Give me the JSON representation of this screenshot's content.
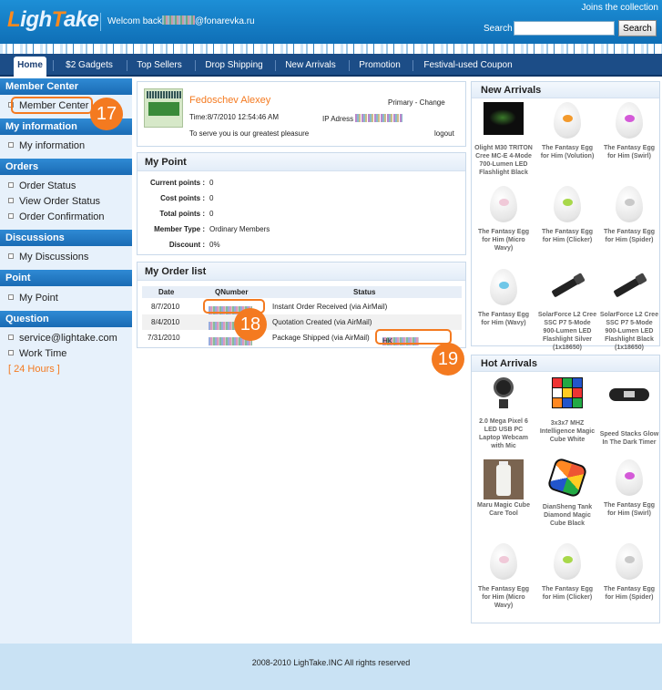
{
  "header": {
    "logo_prefix": "L",
    "logo_mid": "igh",
    "logo_T": "T",
    "logo_rest": "ake",
    "welcome_prefix": "Welcom back",
    "welcome_suffix": "@fonarevka.ru",
    "joins": "Joins the collection",
    "search_label": "Search",
    "search_value": "",
    "search_button": "Search"
  },
  "nav": {
    "items": [
      "Home",
      "$2 Gadgets",
      "Top Sellers",
      "Drop Shipping",
      "New Arrivals",
      "Promotion",
      "Festival-used Coupon"
    ]
  },
  "sidebar": {
    "member_center_head": "Member Center",
    "member_center_item": "Member Center",
    "my_information_head": "My information",
    "my_information_item": "My information",
    "orders_head": "Orders",
    "orders_items": [
      "Order Status",
      "View Order Status",
      "Order Confirmation"
    ],
    "discussions_head": "Discussions",
    "discussions_item": "My Discussions",
    "point_head": "Point",
    "point_item": "My Point",
    "question_head": "Question",
    "question_items": [
      "service@lightake.com",
      "Work Time"
    ],
    "hours": "[ 24 Hours ]"
  },
  "profile": {
    "name": "Fedoschev Alexey",
    "time": "Time:8/7/2010 12:54:46 AM",
    "serve": "To serve you is our greatest pleasure",
    "primary": "Primary - Change",
    "ip_label": "IP Adress",
    "logout": "logout"
  },
  "my_point": {
    "title": "My Point",
    "rows": [
      {
        "label": "Current points :",
        "value": "0"
      },
      {
        "label": "Cost points :",
        "value": "0"
      },
      {
        "label": "Total points :",
        "value": "0"
      },
      {
        "label": "Member Type :",
        "value": "Ordinary Members"
      },
      {
        "label": "Discount :",
        "value": "0%"
      }
    ]
  },
  "orders": {
    "title": "My Order list",
    "headers": {
      "date": "Date",
      "qnumber": "QNumber",
      "status": "Status"
    },
    "rows": [
      {
        "date": "8/7/2010",
        "status": "Instant Order Received (via AirMail)"
      },
      {
        "date": "8/4/2010",
        "status": "Quotation Created (via AirMail)"
      },
      {
        "date": "7/31/2010",
        "status": "Package Shipped (via AirMail)",
        "tracking_prefix": "RB",
        "tracking_suffix": "HK"
      }
    ]
  },
  "callouts": [
    "17",
    "18",
    "19"
  ],
  "new_arrivals": {
    "title": "New Arrivals",
    "items": [
      "Olight M30 TRITON Cree MC-E 4-Mode 700-Lumen LED Flashlight Black",
      "The Fantasy Egg for Him (Volution)",
      "The Fantasy Egg for Him (Swirl)",
      "The Fantasy Egg for Him (Micro Wavy)",
      "The Fantasy Egg for Him (Clicker)",
      "The Fantasy Egg for Him (Spider)",
      "The Fantasy Egg for Him (Wavy)",
      "SolarForce L2 Cree SSC P7 5-Mode 900-Lumen LED Flashlight Silver (1x18650)",
      "SolarForce L2 Cree SSC P7 5-Mode 900-Lumen LED Flashlight Black (1x18650)"
    ]
  },
  "hot_arrivals": {
    "title": "Hot Arrivals",
    "items": [
      "2.0 Mega Pixel 6 LED USB PC Laptop Webcam with Mic",
      "3x3x7 MHZ Intelligence Magic Cube White",
      "Speed Stacks Glow In The Dark Timer",
      "Maru Magic Cube Care Tool",
      "DianSheng Tank Diamond Magic Cube Black",
      "The Fantasy Egg for Him (Swirl)",
      "The Fantasy Egg for Him (Micro Wavy)",
      "The Fantasy Egg for Him (Clicker)",
      "The Fantasy Egg for Him (Spider)"
    ]
  },
  "colors": {
    "accent_orange": "#f47a20",
    "nav_blue": "#1c4d87",
    "header_blue": "#1d8fd6"
  },
  "footer": {
    "copyright": "2008-2010 LighTake.INC All rights reserved"
  }
}
